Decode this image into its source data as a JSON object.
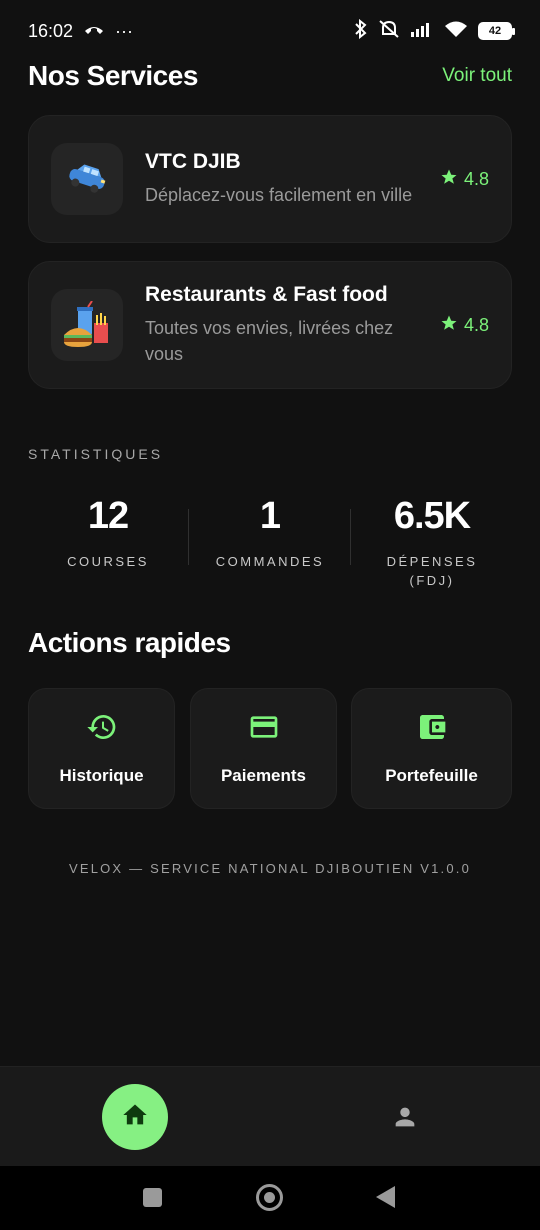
{
  "status_bar": {
    "time": "16:02",
    "dots": "···",
    "battery": "42"
  },
  "services_section": {
    "title": "Nos Services",
    "see_all": "Voir tout",
    "items": [
      {
        "name": "VTC DJIB",
        "description": "Déplacez-vous facilement en ville",
        "rating": "4.8",
        "icon": "car-icon"
      },
      {
        "name": "Restaurants & Fast food",
        "description": "Toutes vos envies, livrées chez vous",
        "rating": "4.8",
        "icon": "fast-food-icon"
      }
    ]
  },
  "stats": {
    "label": "STATISTIQUES",
    "items": [
      {
        "value": "12",
        "label": "COURSES"
      },
      {
        "value": "1",
        "label": "COMMANDES"
      },
      {
        "value": "6.5K",
        "label": "DÉPENSES",
        "sublabel": "(FDJ)"
      }
    ]
  },
  "quick_actions": {
    "title": "Actions rapides",
    "items": [
      {
        "label": "Historique",
        "icon": "history-icon"
      },
      {
        "label": "Paiements",
        "icon": "credit-card-icon"
      },
      {
        "label": "Portefeuille",
        "icon": "wallet-icon"
      }
    ]
  },
  "footer": "VELOX — SERVICE NATIONAL DJIBOUTIEN V1.0.0",
  "bottom_nav": {
    "items": [
      {
        "name": "home",
        "icon": "home-icon",
        "active": true
      },
      {
        "name": "profile",
        "icon": "person-icon",
        "active": false
      }
    ]
  },
  "colors": {
    "accent": "#7cf27a",
    "background": "#111111",
    "card": "#1b1b1b"
  }
}
